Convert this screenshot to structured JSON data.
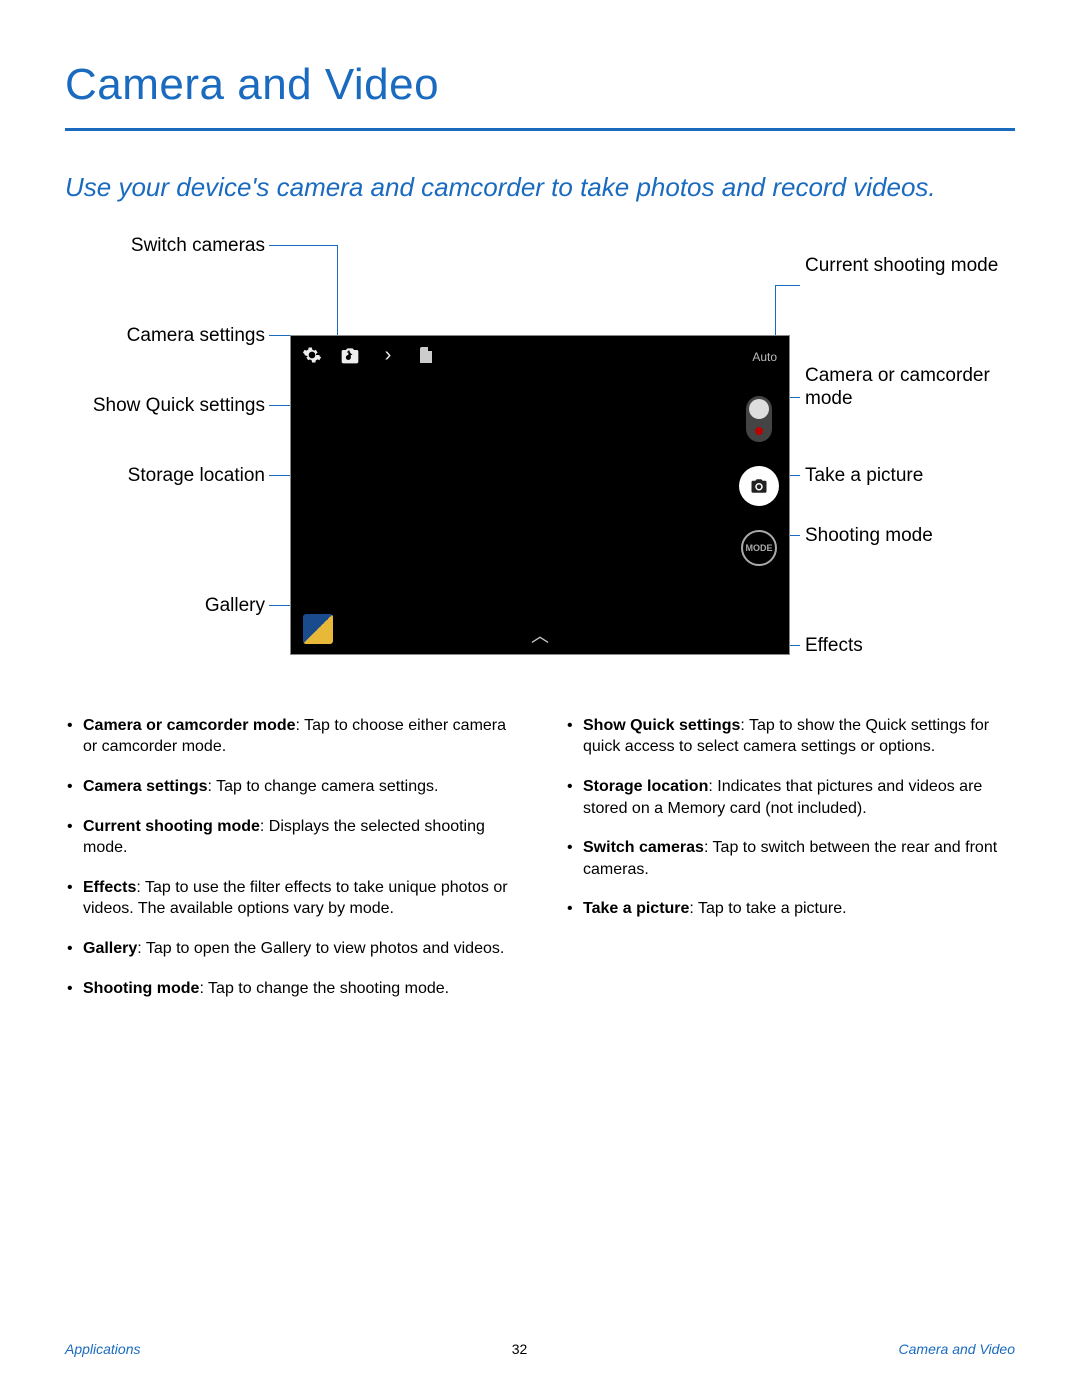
{
  "title": "Camera and Video",
  "subtitle": "Use your device's camera and camcorder to take photos and record videos.",
  "screenshot": {
    "auto_label": "Auto",
    "mode_button": "MODE"
  },
  "callouts": {
    "switch_cameras": "Switch cameras",
    "camera_settings": "Camera settings",
    "show_quick": "Show Quick settings",
    "storage": "Storage location",
    "gallery": "Gallery",
    "current_mode": "Current shooting mode",
    "cam_or_camcorder": "Camera or camcorder mode",
    "take_picture": "Take a picture",
    "shooting_mode": "Shooting mode",
    "effects": "Effects"
  },
  "left_col": [
    {
      "term": "Camera or camcorder mode",
      "desc": ": Tap to choose either camera or camcorder mode."
    },
    {
      "term": "Camera settings",
      "desc": ": Tap to change camera settings."
    },
    {
      "term": "Current shooting mode",
      "desc": ": Displays the selected shooting mode."
    },
    {
      "term": "Effects",
      "desc": ": Tap to use the filter effects to take unique photos or videos. The available options vary by mode."
    },
    {
      "term": "Gallery",
      "desc": ": Tap to open the Gallery to view photos and videos."
    },
    {
      "term": "Shooting mode",
      "desc": ": Tap to change the shooting mode."
    }
  ],
  "right_col": [
    {
      "term": "Show Quick settings",
      "desc": ": Tap to show the Quick settings for quick access to select camera settings or options."
    },
    {
      "term": "Storage location",
      "desc": ": Indicates that pictures and videos are stored on a Memory card (not included)."
    },
    {
      "term": "Switch cameras",
      "desc": ": Tap to switch between the rear and front cameras."
    },
    {
      "term": "Take a picture",
      "desc": ": Tap to take a picture."
    }
  ],
  "footer": {
    "left": "Applications",
    "page": "32",
    "right": "Camera and Video"
  }
}
